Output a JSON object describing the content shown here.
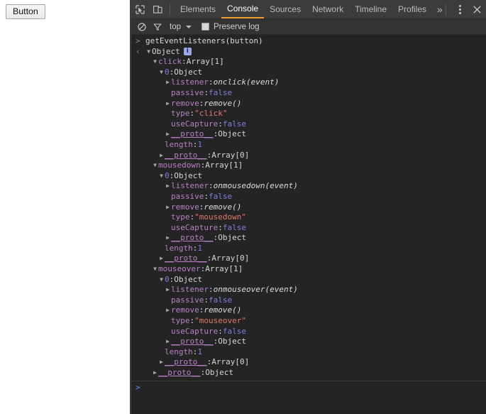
{
  "page": {
    "button_label": "Button"
  },
  "devtools": {
    "toolbar": {
      "inspect_icon": "inspect-cursor-icon",
      "device_icon": "device-toolbar-icon",
      "more_tabs_label": "»",
      "close_label": "✕",
      "tabs": [
        {
          "label": "Elements",
          "selected": false
        },
        {
          "label": "Console",
          "selected": true
        },
        {
          "label": "Sources",
          "selected": false
        },
        {
          "label": "Network",
          "selected": false
        },
        {
          "label": "Timeline",
          "selected": false
        },
        {
          "label": "Profiles",
          "selected": false
        }
      ]
    },
    "filterbar": {
      "clear_icon": "clear-console-icon",
      "filter_icon": "filter-funnel-icon",
      "context_value": "top",
      "preserve_log_label": "Preserve log",
      "preserve_log_checked": false
    },
    "console": {
      "input_line": "getEventListeners(button)",
      "input_marker": ">",
      "result_marker": "‹",
      "prompt_marker": ">",
      "rows": [
        {
          "indent": 0,
          "tri": "▼",
          "type": "object-head",
          "name": "Object",
          "badge": true
        },
        {
          "indent": 1,
          "tri": "▼",
          "type": "prop-val",
          "name": "click",
          "value": "Array[1]",
          "vclass": "t-obj"
        },
        {
          "indent": 2,
          "tri": "▼",
          "type": "prop-val",
          "name": "0",
          "nclass": "t-num",
          "value": "Object",
          "vclass": "t-obj"
        },
        {
          "indent": 3,
          "tri": "▶",
          "type": "prop-val",
          "name": "listener",
          "value": "onclick(event)",
          "vclass": "t-fn"
        },
        {
          "indent": 3,
          "tri": "",
          "type": "prop-val",
          "name": "passive",
          "value": "false",
          "vclass": "t-bool"
        },
        {
          "indent": 3,
          "tri": "▶",
          "type": "prop-val",
          "name": "remove",
          "value": "remove()",
          "vclass": "t-fn"
        },
        {
          "indent": 3,
          "tri": "",
          "type": "prop-val",
          "name": "type",
          "value": "\"click\"",
          "vclass": "t-str"
        },
        {
          "indent": 3,
          "tri": "",
          "type": "prop-val",
          "name": "useCapture",
          "value": "false",
          "vclass": "t-bool"
        },
        {
          "indent": 3,
          "tri": "▶",
          "type": "prop-val",
          "name": "__proto__",
          "nclass": "t-proto",
          "value": "Object",
          "vclass": "t-obj"
        },
        {
          "indent": 2,
          "tri": "",
          "type": "prop-val",
          "name": "length",
          "value": "1",
          "vclass": "t-num"
        },
        {
          "indent": 2,
          "tri": "▶",
          "type": "prop-val",
          "name": "__proto__",
          "nclass": "t-proto",
          "value": "Array[0]",
          "vclass": "t-obj"
        },
        {
          "indent": 1,
          "tri": "▼",
          "type": "prop-val",
          "name": "mousedown",
          "value": "Array[1]",
          "vclass": "t-obj"
        },
        {
          "indent": 2,
          "tri": "▼",
          "type": "prop-val",
          "name": "0",
          "nclass": "t-num",
          "value": "Object",
          "vclass": "t-obj"
        },
        {
          "indent": 3,
          "tri": "▶",
          "type": "prop-val",
          "name": "listener",
          "value": "onmousedown(event)",
          "vclass": "t-fn"
        },
        {
          "indent": 3,
          "tri": "",
          "type": "prop-val",
          "name": "passive",
          "value": "false",
          "vclass": "t-bool"
        },
        {
          "indent": 3,
          "tri": "▶",
          "type": "prop-val",
          "name": "remove",
          "value": "remove()",
          "vclass": "t-fn"
        },
        {
          "indent": 3,
          "tri": "",
          "type": "prop-val",
          "name": "type",
          "value": "\"mousedown\"",
          "vclass": "t-str"
        },
        {
          "indent": 3,
          "tri": "",
          "type": "prop-val",
          "name": "useCapture",
          "value": "false",
          "vclass": "t-bool"
        },
        {
          "indent": 3,
          "tri": "▶",
          "type": "prop-val",
          "name": "__proto__",
          "nclass": "t-proto",
          "value": "Object",
          "vclass": "t-obj"
        },
        {
          "indent": 2,
          "tri": "",
          "type": "prop-val",
          "name": "length",
          "value": "1",
          "vclass": "t-num"
        },
        {
          "indent": 2,
          "tri": "▶",
          "type": "prop-val",
          "name": "__proto__",
          "nclass": "t-proto",
          "value": "Array[0]",
          "vclass": "t-obj"
        },
        {
          "indent": 1,
          "tri": "▼",
          "type": "prop-val",
          "name": "mouseover",
          "value": "Array[1]",
          "vclass": "t-obj"
        },
        {
          "indent": 2,
          "tri": "▼",
          "type": "prop-val",
          "name": "0",
          "nclass": "t-num",
          "value": "Object",
          "vclass": "t-obj"
        },
        {
          "indent": 3,
          "tri": "▶",
          "type": "prop-val",
          "name": "listener",
          "value": "onmouseover(event)",
          "vclass": "t-fn"
        },
        {
          "indent": 3,
          "tri": "",
          "type": "prop-val",
          "name": "passive",
          "value": "false",
          "vclass": "t-bool"
        },
        {
          "indent": 3,
          "tri": "▶",
          "type": "prop-val",
          "name": "remove",
          "value": "remove()",
          "vclass": "t-fn"
        },
        {
          "indent": 3,
          "tri": "",
          "type": "prop-val",
          "name": "type",
          "value": "\"mouseover\"",
          "vclass": "t-str"
        },
        {
          "indent": 3,
          "tri": "",
          "type": "prop-val",
          "name": "useCapture",
          "value": "false",
          "vclass": "t-bool"
        },
        {
          "indent": 3,
          "tri": "▶",
          "type": "prop-val",
          "name": "__proto__",
          "nclass": "t-proto",
          "value": "Object",
          "vclass": "t-obj"
        },
        {
          "indent": 2,
          "tri": "",
          "type": "prop-val",
          "name": "length",
          "value": "1",
          "vclass": "t-num"
        },
        {
          "indent": 2,
          "tri": "▶",
          "type": "prop-val",
          "name": "__proto__",
          "nclass": "t-proto",
          "value": "Array[0]",
          "vclass": "t-obj"
        },
        {
          "indent": 1,
          "tri": "▶",
          "type": "prop-val",
          "name": "__proto__",
          "nclass": "t-proto",
          "value": "Object",
          "vclass": "t-obj"
        }
      ]
    }
  },
  "colors": {
    "devtools_bg": "#242424",
    "toolbar_bg": "#3c3c3c",
    "filterbar_bg": "#333333",
    "accent_tab": "#f0a033",
    "property": "#bb80c8",
    "boolean": "#7f7fe0",
    "string": "#e2776a",
    "prompt": "#5a8ff0"
  }
}
